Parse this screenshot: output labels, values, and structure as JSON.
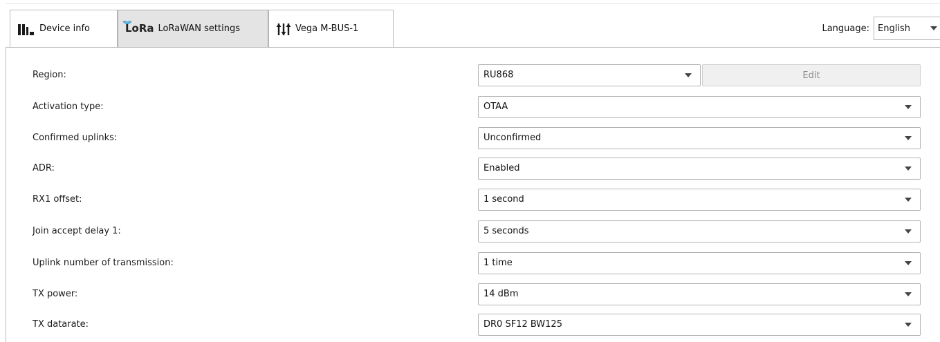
{
  "tabs": [
    {
      "label": "Device info",
      "icon": "bar-chart-icon",
      "active": false
    },
    {
      "label": "LoRaWAN settings",
      "icon": "lora-logo-icon",
      "logo_text": "LoRa",
      "active": true
    },
    {
      "label": "Vega M-BUS-1",
      "icon": "sliders-icon",
      "active": false
    }
  ],
  "language": {
    "label": "Language:",
    "value": "English"
  },
  "settings": {
    "region": {
      "label": "Region:",
      "value": "RU868",
      "edit_label": "Edit"
    },
    "activation_type": {
      "label": "Activation type:",
      "value": "OTAA"
    },
    "confirmed_uplinks": {
      "label": "Confirmed uplinks:",
      "value": "Unconfirmed"
    },
    "adr": {
      "label": "ADR:",
      "value": "Enabled"
    },
    "rx1_offset": {
      "label": "RX1 offset:",
      "value": "1 second"
    },
    "join_accept_delay_1": {
      "label": "Join accept delay 1:",
      "value": "5 seconds"
    },
    "uplink_number_of_transmission": {
      "label": "Uplink number of transmission:",
      "value": "1 time"
    },
    "tx_power": {
      "label": "TX power:",
      "value": "14 dBm"
    },
    "tx_datarate": {
      "label": "TX datarate:",
      "value": "DR0 SF12 BW125"
    }
  },
  "colors": {
    "active_tab_bg": "#e4e4e4",
    "border": "#b9b9b9",
    "disabled_text": "#8d8d8d"
  }
}
